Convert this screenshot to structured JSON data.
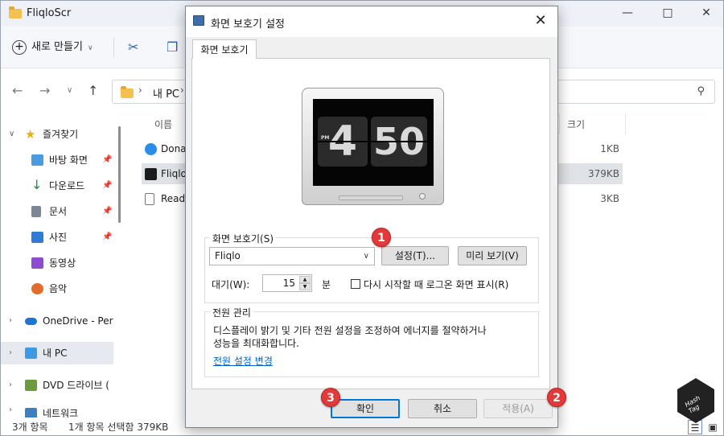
{
  "explorer": {
    "title": "FliqloScr",
    "new_label": "새로 만들기",
    "address": "내 PC",
    "columns": {
      "name": "이름",
      "size": "크기"
    },
    "sidebar": [
      {
        "label": "즐겨찾기",
        "level": 0
      },
      {
        "label": "바탕 화면",
        "level": 1
      },
      {
        "label": "다운로드",
        "level": 1
      },
      {
        "label": "문서",
        "level": 1
      },
      {
        "label": "사진",
        "level": 1
      },
      {
        "label": "동영상",
        "level": 1
      },
      {
        "label": "음악",
        "level": 1
      },
      {
        "label": "OneDrive - Perso",
        "level": 0
      },
      {
        "label": "내 PC",
        "level": 0
      },
      {
        "label": "DVD 드라이브 (",
        "level": 0
      },
      {
        "label": "네트워크",
        "level": 0
      }
    ],
    "files": [
      {
        "name": "Donat",
        "size": "1KB"
      },
      {
        "name": "Fliqlo.",
        "size": "379KB"
      },
      {
        "name": "ReadM",
        "size": "3KB"
      }
    ],
    "status": {
      "count": "3개 항목",
      "selected": "1개 항목 선택함 379KB"
    }
  },
  "dialog": {
    "title": "화면 보호기 설정",
    "tab": "화면 보호기",
    "preview": {
      "hour": "4",
      "minute": "50",
      "ampm": "PM"
    },
    "screensaver_group": "화면 보호기(S)",
    "screensaver_value": "Fliqlo",
    "settings_button": "설정(T)...",
    "preview_button": "미리 보기(V)",
    "wait_label": "대기(W):",
    "wait_value": "15",
    "wait_unit": "분",
    "resume_label": "다시 시작할 때 로그온 화면 표시(R)",
    "power_group": "전원 관리",
    "power_text_1": "디스플레이 밝기 및 기타 전원 설정을 조정하여 에너지를 절약하거나",
    "power_text_2": "성능을 최대화합니다.",
    "power_link": "전원 설정 변경",
    "ok": "확인",
    "cancel": "취소",
    "apply": "적용(A)"
  },
  "badges": [
    "1",
    "2",
    "3"
  ],
  "watermark": "Hash Tag"
}
